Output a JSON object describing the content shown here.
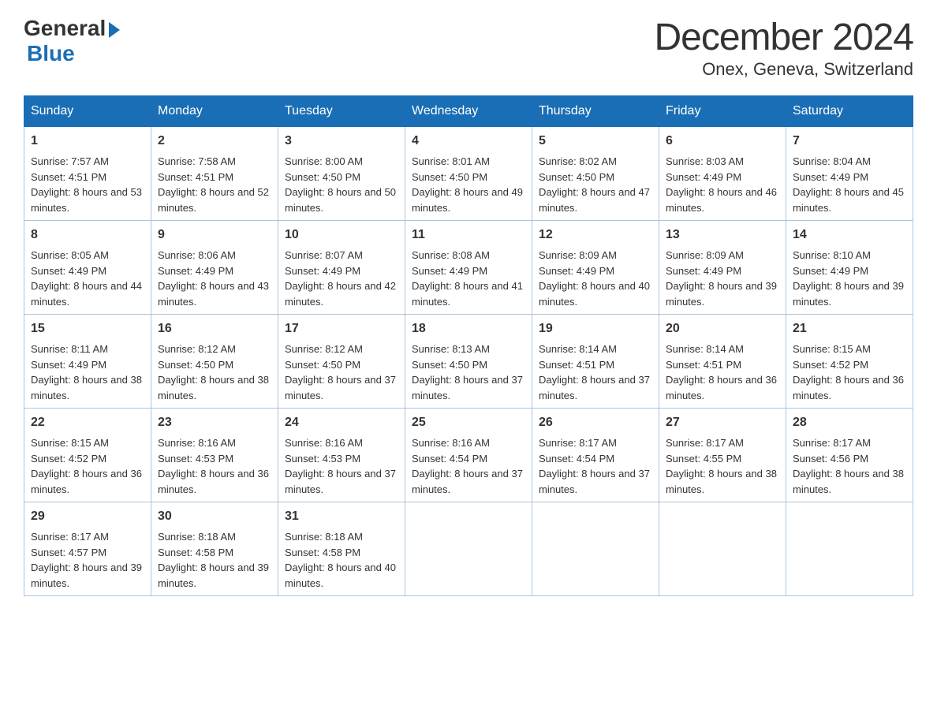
{
  "logo": {
    "general": "General",
    "blue": "Blue"
  },
  "title": {
    "month_year": "December 2024",
    "location": "Onex, Geneva, Switzerland"
  },
  "days_of_week": [
    "Sunday",
    "Monday",
    "Tuesday",
    "Wednesday",
    "Thursday",
    "Friday",
    "Saturday"
  ],
  "weeks": [
    [
      {
        "day": "1",
        "sunrise": "7:57 AM",
        "sunset": "4:51 PM",
        "daylight": "8 hours and 53 minutes."
      },
      {
        "day": "2",
        "sunrise": "7:58 AM",
        "sunset": "4:51 PM",
        "daylight": "8 hours and 52 minutes."
      },
      {
        "day": "3",
        "sunrise": "8:00 AM",
        "sunset": "4:50 PM",
        "daylight": "8 hours and 50 minutes."
      },
      {
        "day": "4",
        "sunrise": "8:01 AM",
        "sunset": "4:50 PM",
        "daylight": "8 hours and 49 minutes."
      },
      {
        "day": "5",
        "sunrise": "8:02 AM",
        "sunset": "4:50 PM",
        "daylight": "8 hours and 47 minutes."
      },
      {
        "day": "6",
        "sunrise": "8:03 AM",
        "sunset": "4:49 PM",
        "daylight": "8 hours and 46 minutes."
      },
      {
        "day": "7",
        "sunrise": "8:04 AM",
        "sunset": "4:49 PM",
        "daylight": "8 hours and 45 minutes."
      }
    ],
    [
      {
        "day": "8",
        "sunrise": "8:05 AM",
        "sunset": "4:49 PM",
        "daylight": "8 hours and 44 minutes."
      },
      {
        "day": "9",
        "sunrise": "8:06 AM",
        "sunset": "4:49 PM",
        "daylight": "8 hours and 43 minutes."
      },
      {
        "day": "10",
        "sunrise": "8:07 AM",
        "sunset": "4:49 PM",
        "daylight": "8 hours and 42 minutes."
      },
      {
        "day": "11",
        "sunrise": "8:08 AM",
        "sunset": "4:49 PM",
        "daylight": "8 hours and 41 minutes."
      },
      {
        "day": "12",
        "sunrise": "8:09 AM",
        "sunset": "4:49 PM",
        "daylight": "8 hours and 40 minutes."
      },
      {
        "day": "13",
        "sunrise": "8:09 AM",
        "sunset": "4:49 PM",
        "daylight": "8 hours and 39 minutes."
      },
      {
        "day": "14",
        "sunrise": "8:10 AM",
        "sunset": "4:49 PM",
        "daylight": "8 hours and 39 minutes."
      }
    ],
    [
      {
        "day": "15",
        "sunrise": "8:11 AM",
        "sunset": "4:49 PM",
        "daylight": "8 hours and 38 minutes."
      },
      {
        "day": "16",
        "sunrise": "8:12 AM",
        "sunset": "4:50 PM",
        "daylight": "8 hours and 38 minutes."
      },
      {
        "day": "17",
        "sunrise": "8:12 AM",
        "sunset": "4:50 PM",
        "daylight": "8 hours and 37 minutes."
      },
      {
        "day": "18",
        "sunrise": "8:13 AM",
        "sunset": "4:50 PM",
        "daylight": "8 hours and 37 minutes."
      },
      {
        "day": "19",
        "sunrise": "8:14 AM",
        "sunset": "4:51 PM",
        "daylight": "8 hours and 37 minutes."
      },
      {
        "day": "20",
        "sunrise": "8:14 AM",
        "sunset": "4:51 PM",
        "daylight": "8 hours and 36 minutes."
      },
      {
        "day": "21",
        "sunrise": "8:15 AM",
        "sunset": "4:52 PM",
        "daylight": "8 hours and 36 minutes."
      }
    ],
    [
      {
        "day": "22",
        "sunrise": "8:15 AM",
        "sunset": "4:52 PM",
        "daylight": "8 hours and 36 minutes."
      },
      {
        "day": "23",
        "sunrise": "8:16 AM",
        "sunset": "4:53 PM",
        "daylight": "8 hours and 36 minutes."
      },
      {
        "day": "24",
        "sunrise": "8:16 AM",
        "sunset": "4:53 PM",
        "daylight": "8 hours and 37 minutes."
      },
      {
        "day": "25",
        "sunrise": "8:16 AM",
        "sunset": "4:54 PM",
        "daylight": "8 hours and 37 minutes."
      },
      {
        "day": "26",
        "sunrise": "8:17 AM",
        "sunset": "4:54 PM",
        "daylight": "8 hours and 37 minutes."
      },
      {
        "day": "27",
        "sunrise": "8:17 AM",
        "sunset": "4:55 PM",
        "daylight": "8 hours and 38 minutes."
      },
      {
        "day": "28",
        "sunrise": "8:17 AM",
        "sunset": "4:56 PM",
        "daylight": "8 hours and 38 minutes."
      }
    ],
    [
      {
        "day": "29",
        "sunrise": "8:17 AM",
        "sunset": "4:57 PM",
        "daylight": "8 hours and 39 minutes."
      },
      {
        "day": "30",
        "sunrise": "8:18 AM",
        "sunset": "4:58 PM",
        "daylight": "8 hours and 39 minutes."
      },
      {
        "day": "31",
        "sunrise": "8:18 AM",
        "sunset": "4:58 PM",
        "daylight": "8 hours and 40 minutes."
      },
      null,
      null,
      null,
      null
    ]
  ]
}
